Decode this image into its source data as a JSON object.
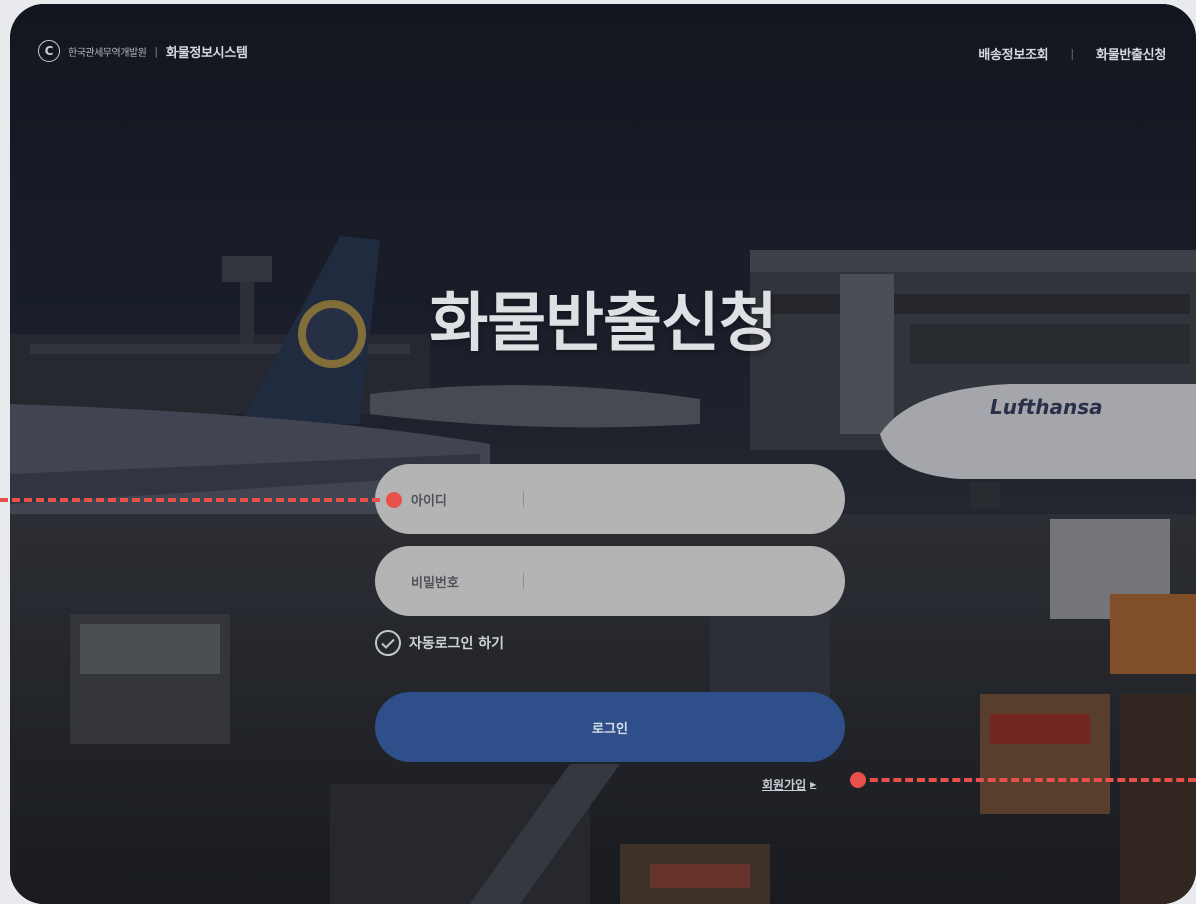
{
  "header": {
    "org_name": "한국관세무역개발원",
    "system_name": "화물정보시스템",
    "nav": [
      {
        "label": "배송정보조회"
      },
      {
        "label": "화물반출신청"
      }
    ]
  },
  "main": {
    "title": "화물반출신청",
    "id_field": {
      "label": "아이디",
      "value": ""
    },
    "pw_field": {
      "label": "비밀번호",
      "value": ""
    },
    "auto_login": {
      "label": "자동로그인 하기",
      "checked": true
    },
    "login_button": "로그인",
    "signup_link": "회원가입"
  },
  "theme": {
    "button_color": "#2f4f8a",
    "input_bg": "#b4b4b5",
    "marker_color": "#e8504b"
  },
  "icons": {
    "brand": "customs-logo-icon",
    "check": "check-circle-icon",
    "signup_arrow": "triangle-right-icon"
  }
}
